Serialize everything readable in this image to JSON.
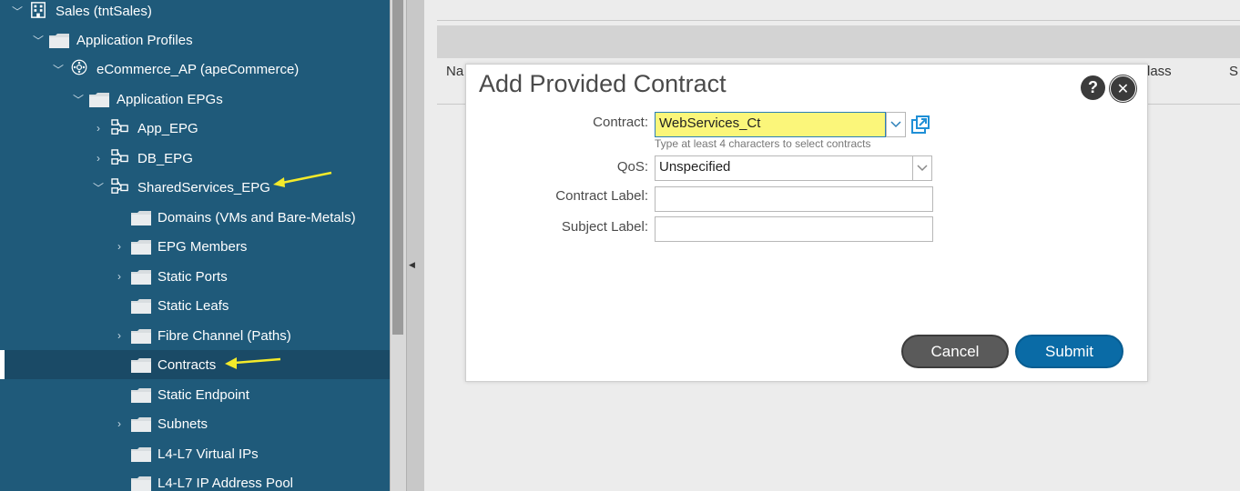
{
  "tree": {
    "items": [
      {
        "label": "Sales (tntSales)",
        "icon": "building-icon"
      },
      {
        "label": "Application Profiles",
        "icon": "folder-icon"
      },
      {
        "label": "eCommerce_AP (apeCommerce)",
        "icon": "app-profile-icon"
      },
      {
        "label": "Application EPGs",
        "icon": "folder-icon"
      },
      {
        "label": "App_EPG",
        "icon": "epg-icon"
      },
      {
        "label": "DB_EPG",
        "icon": "epg-icon"
      },
      {
        "label": "SharedServices_EPG",
        "icon": "epg-icon"
      },
      {
        "label": "Domains (VMs and Bare-Metals)",
        "icon": "folder-icon"
      },
      {
        "label": "EPG Members",
        "icon": "folder-icon"
      },
      {
        "label": "Static Ports",
        "icon": "folder-icon"
      },
      {
        "label": "Static Leafs",
        "icon": "folder-icon"
      },
      {
        "label": "Fibre Channel (Paths)",
        "icon": "folder-icon"
      },
      {
        "label": "Contracts",
        "icon": "folder-icon"
      },
      {
        "label": "Static Endpoint",
        "icon": "folder-icon"
      },
      {
        "label": "Subnets",
        "icon": "folder-icon"
      },
      {
        "label": "L4-L7 Virtual IPs",
        "icon": "folder-icon"
      },
      {
        "label": "L4-L7 IP Address Pool",
        "icon": "folder-icon"
      }
    ]
  },
  "background": {
    "col_name": "Na",
    "col_class": "lass",
    "col_s": "S"
  },
  "modal": {
    "title": "Add Provided Contract",
    "help_glyph": "?",
    "close_glyph": "✕",
    "contract_label": "Contract:",
    "contract_value": "WebServices_Ct",
    "contract_hint": "Type at least 4 characters to select contracts",
    "qos_label": "QoS:",
    "qos_value": "Unspecified",
    "contract_label_label": "Contract Label:",
    "subject_label_label": "Subject Label:",
    "cancel": "Cancel",
    "submit": "Submit"
  },
  "colors": {
    "sidebar": "#1f5a7a",
    "highlight": "#fbf67a",
    "arrow": "#f4ea2a",
    "submit": "#0a6ba6",
    "cancel": "#5a5a5a"
  }
}
